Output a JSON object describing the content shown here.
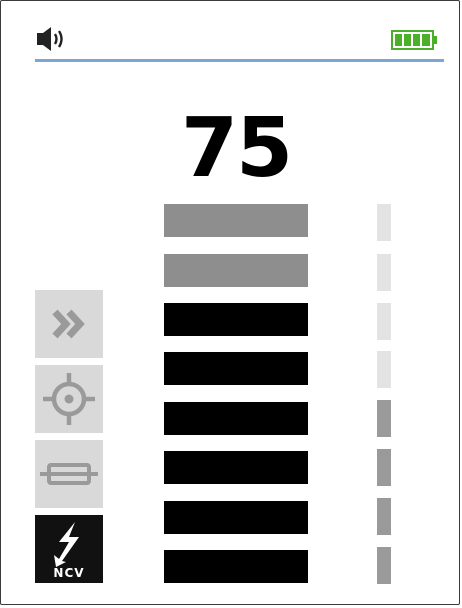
{
  "status": {
    "speaker_icon": "speaker-icon",
    "battery_icon": "battery-icon",
    "line_color": "#7ba6d8",
    "battery_color": "#4caf2a"
  },
  "reading": {
    "value": "75"
  },
  "meter": {
    "segments": [
      "gray",
      "gray",
      "black",
      "black",
      "black",
      "black",
      "black",
      "black"
    ],
    "level_ticks": [
      "light",
      "light",
      "light",
      "light",
      "dark",
      "dark",
      "dark",
      "dark"
    ],
    "colors": {
      "gray": "#8e8e8e",
      "black": "#000000",
      "tick_light": "#e3e3e3",
      "tick_dark": "#9a9a9a"
    }
  },
  "modes": [
    {
      "icon": "fast-forward-icon",
      "active": false
    },
    {
      "icon": "target-icon",
      "active": false
    },
    {
      "icon": "fuse-icon",
      "active": false
    },
    {
      "icon": "ncv-lightning-icon",
      "active": true,
      "label": "NCV"
    }
  ]
}
